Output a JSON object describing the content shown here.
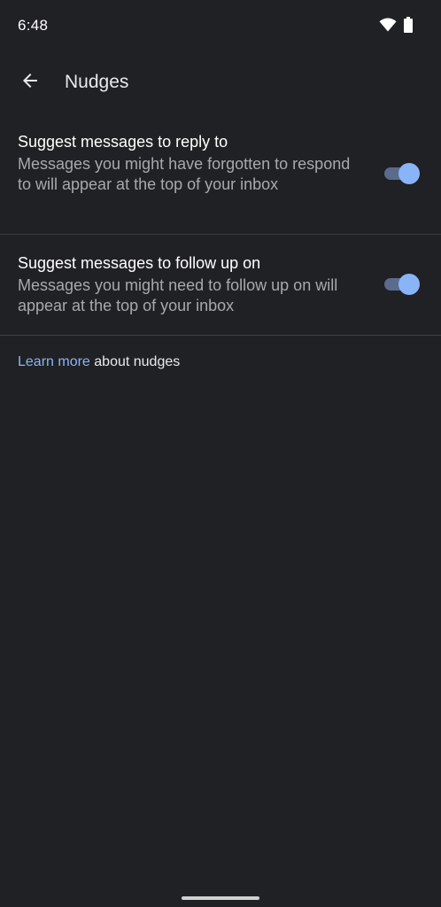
{
  "status_bar": {
    "time": "6:48",
    "icons": [
      "wifi-icon",
      "battery-icon"
    ]
  },
  "app_bar": {
    "back_icon": "arrow-back-icon",
    "title": "Nudges"
  },
  "settings": [
    {
      "title": "Suggest messages to reply to",
      "summary": "Messages you might have forgotten to respond to will appear at the top of your inbox",
      "enabled": true
    },
    {
      "title": "Suggest messages to follow up on",
      "summary": "Messages you might need to follow up on will appear at the top of your inbox",
      "enabled": true
    }
  ],
  "footer": {
    "link_text": "Learn more",
    "rest_text": " about nudges"
  },
  "colors": {
    "background": "#202124",
    "accent": "#8ab4f8",
    "divider": "#3c4043",
    "secondary_text": "#a7a9ad"
  }
}
